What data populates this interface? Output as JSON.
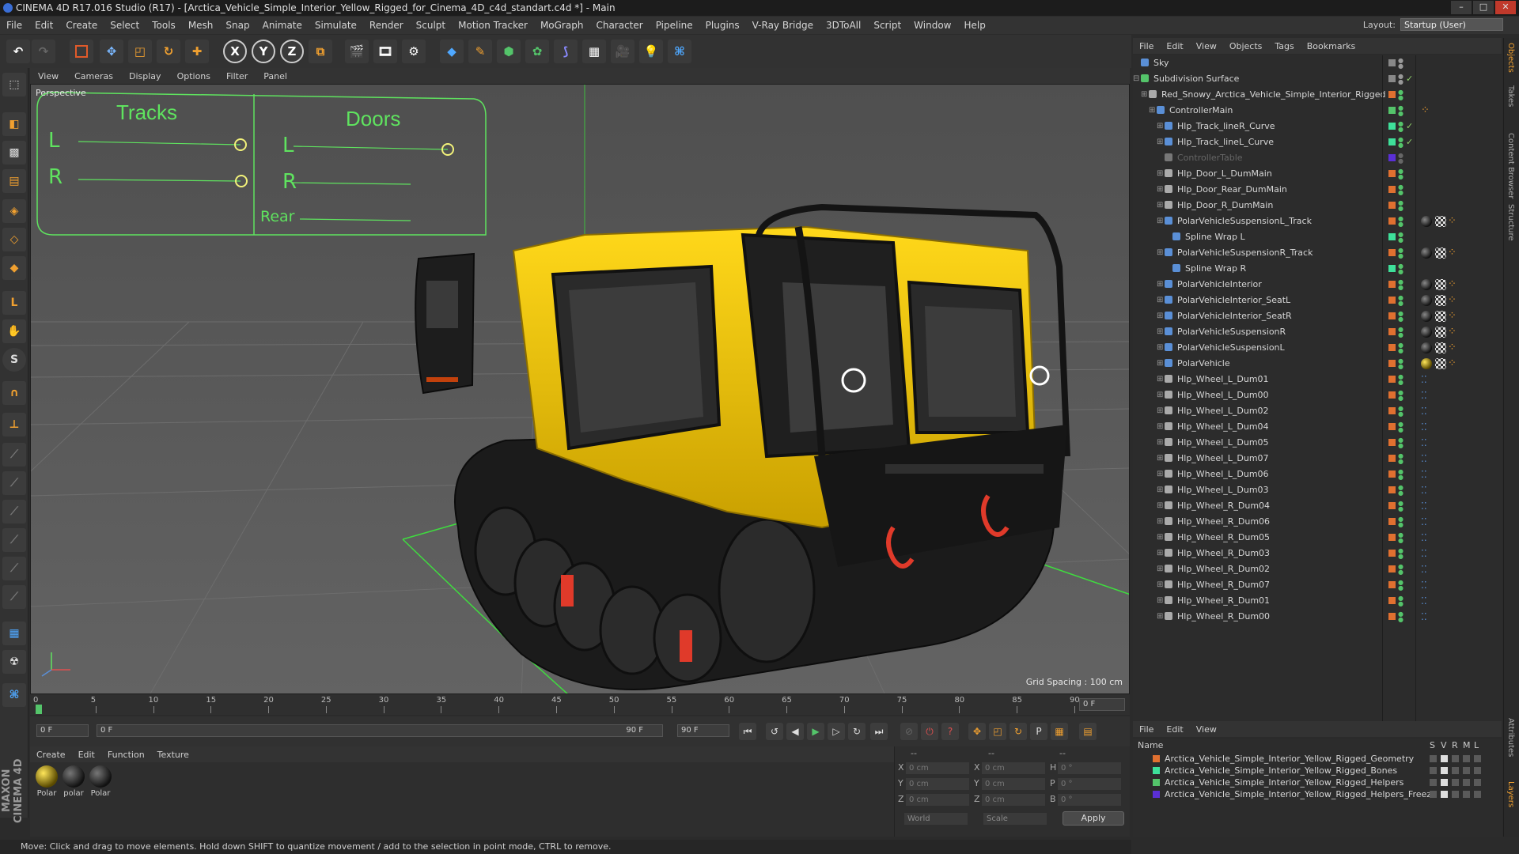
{
  "window": {
    "title": "CINEMA 4D R17.016 Studio (R17) - [Arctica_Vehicle_Simple_Interior_Yellow_Rigged_for_Cinema_4D_c4d_standart.c4d *] - Main"
  },
  "menubar": {
    "items": [
      "File",
      "Edit",
      "Create",
      "Select",
      "Tools",
      "Mesh",
      "Snap",
      "Animate",
      "Simulate",
      "Render",
      "Sculpt",
      "Motion Tracker",
      "MoGraph",
      "Character",
      "Pipeline",
      "Plugins",
      "V-Ray Bridge",
      "3DToAll",
      "Script",
      "Window",
      "Help"
    ],
    "layout_label": "Layout:",
    "layout_value": "Startup (User)"
  },
  "toolbar": {
    "axis_x": "X",
    "axis_y": "Y",
    "axis_z": "Z"
  },
  "viewport": {
    "menu": [
      "View",
      "Cameras",
      "Display",
      "Options",
      "Filter",
      "Panel"
    ],
    "label": "Perspective",
    "grid_spacing": "Grid Spacing : 100 cm",
    "hud": {
      "tracks": "Tracks",
      "doors": "Doors",
      "l": "L",
      "r": "R",
      "rear": "Rear"
    },
    "colors": {
      "bg": "#5b5b5b",
      "body": "#f2c800",
      "hud": "#5fe35f"
    }
  },
  "timeline": {
    "ticks": [
      "0",
      "5",
      "10",
      "15",
      "20",
      "25",
      "30",
      "35",
      "40",
      "45",
      "50",
      "55",
      "60",
      "65",
      "70",
      "75",
      "80",
      "85",
      "90"
    ],
    "current_frame": "0 F",
    "start_field": "0 F",
    "range_start": "0 F",
    "range_end": "90 F",
    "end_field": "90 F"
  },
  "materials": {
    "menu": [
      "Create",
      "Edit",
      "Function",
      "Texture"
    ],
    "items": [
      "Polar",
      "polar",
      "Polar"
    ]
  },
  "coords": {
    "header": [
      "--",
      "--",
      "--"
    ],
    "rows": [
      {
        "a": "X",
        "av": "0 cm",
        "b": "X",
        "bv": "0 cm",
        "c": "H",
        "cv": "0 °"
      },
      {
        "a": "Y",
        "av": "0 cm",
        "b": "Y",
        "bv": "0 cm",
        "c": "P",
        "cv": "0 °"
      },
      {
        "a": "Z",
        "av": "0 cm",
        "b": "Z",
        "bv": "0 cm",
        "c": "B",
        "cv": "0 °"
      }
    ],
    "mode": "World",
    "scale": "Scale",
    "apply": "Apply"
  },
  "status": {
    "text": "Move: Click and drag to move elements. Hold down SHIFT to quantize movement / add to the selection in point mode, CTRL to remove."
  },
  "object_manager": {
    "menu": [
      "File",
      "Edit",
      "View",
      "Objects",
      "Tags",
      "Bookmarks"
    ],
    "objects": [
      {
        "name": "Sky",
        "indent": 0,
        "layer": "#888888",
        "icon": "#5a8fd6"
      },
      {
        "name": "Subdivision Surface",
        "indent": 0,
        "layer": "#888888",
        "icon": "#54c46a",
        "check": true
      },
      {
        "name": "Red_Snowy_Arctica_Vehicle_Simple_Interior_Rigged",
        "indent": 1,
        "layer": "#e07030",
        "icon": "#aaaaaa"
      },
      {
        "name": "ControllerMain",
        "indent": 2,
        "layer": "#54c46a",
        "icon": "#5a8fd6",
        "tag": "ik"
      },
      {
        "name": "Hlp_Track_lineR_Curve",
        "indent": 3,
        "layer": "#3ee09a",
        "icon": "#5a8fd6",
        "check": true
      },
      {
        "name": "Hlp_Track_lineL_Curve",
        "indent": 3,
        "layer": "#3ee09a",
        "icon": "#5a8fd6",
        "check": true
      },
      {
        "name": "ControllerTable",
        "indent": 3,
        "layer": "#5a2fd6",
        "icon": "#777777",
        "dim": true
      },
      {
        "name": "Hlp_Door_L_DumMain",
        "indent": 3,
        "layer": "#e07030",
        "icon": "#aaaaaa"
      },
      {
        "name": "Hlp_Door_Rear_DumMain",
        "indent": 3,
        "layer": "#e07030",
        "icon": "#aaaaaa"
      },
      {
        "name": "Hlp_Door_R_DumMain",
        "indent": 3,
        "layer": "#e07030",
        "icon": "#aaaaaa"
      },
      {
        "name": "PolarVehicleSuspensionL_Track",
        "indent": 3,
        "layer": "#e07030",
        "icon": "#5a8fd6",
        "tag": "mat"
      },
      {
        "name": "Spline Wrap L",
        "indent": 4,
        "layer": "#3ee09a",
        "icon": "#5a8fd6"
      },
      {
        "name": "PolarVehicleSuspensionR_Track",
        "indent": 3,
        "layer": "#e07030",
        "icon": "#5a8fd6",
        "tag": "mat"
      },
      {
        "name": "Spline Wrap R",
        "indent": 4,
        "layer": "#3ee09a",
        "icon": "#5a8fd6"
      },
      {
        "name": "PolarVehicleInterior",
        "indent": 3,
        "layer": "#e07030",
        "icon": "#5a8fd6",
        "tag": "mat"
      },
      {
        "name": "PolarVehicleInterior_SeatL",
        "indent": 3,
        "layer": "#e07030",
        "icon": "#5a8fd6",
        "tag": "mat"
      },
      {
        "name": "PolarVehicleInterior_SeatR",
        "indent": 3,
        "layer": "#e07030",
        "icon": "#5a8fd6",
        "tag": "mat"
      },
      {
        "name": "PolarVehicleSuspensionR",
        "indent": 3,
        "layer": "#e07030",
        "icon": "#5a8fd6",
        "tag": "mat"
      },
      {
        "name": "PolarVehicleSuspensionL",
        "indent": 3,
        "layer": "#e07030",
        "icon": "#5a8fd6",
        "tag": "mat"
      },
      {
        "name": "PolarVehicle",
        "indent": 3,
        "layer": "#e07030",
        "icon": "#5a8fd6",
        "tag": "matY"
      },
      {
        "name": "Hlp_Wheel_L_Dum01",
        "indent": 3,
        "layer": "#e07030",
        "icon": "#aaaaaa",
        "tag": "dots"
      },
      {
        "name": "Hlp_Wheel_L_Dum00",
        "indent": 3,
        "layer": "#e07030",
        "icon": "#aaaaaa",
        "tag": "dots"
      },
      {
        "name": "Hlp_Wheel_L_Dum02",
        "indent": 3,
        "layer": "#e07030",
        "icon": "#aaaaaa",
        "tag": "dots"
      },
      {
        "name": "Hlp_Wheel_L_Dum04",
        "indent": 3,
        "layer": "#e07030",
        "icon": "#aaaaaa",
        "tag": "dots"
      },
      {
        "name": "Hlp_Wheel_L_Dum05",
        "indent": 3,
        "layer": "#e07030",
        "icon": "#aaaaaa",
        "tag": "dots"
      },
      {
        "name": "Hlp_Wheel_L_Dum07",
        "indent": 3,
        "layer": "#e07030",
        "icon": "#aaaaaa",
        "tag": "dots"
      },
      {
        "name": "Hlp_Wheel_L_Dum06",
        "indent": 3,
        "layer": "#e07030",
        "icon": "#aaaaaa",
        "tag": "dots"
      },
      {
        "name": "Hlp_Wheel_L_Dum03",
        "indent": 3,
        "layer": "#e07030",
        "icon": "#aaaaaa",
        "tag": "dots"
      },
      {
        "name": "Hlp_Wheel_R_Dum04",
        "indent": 3,
        "layer": "#e07030",
        "icon": "#aaaaaa",
        "tag": "dots"
      },
      {
        "name": "Hlp_Wheel_R_Dum06",
        "indent": 3,
        "layer": "#e07030",
        "icon": "#aaaaaa",
        "tag": "dots"
      },
      {
        "name": "Hlp_Wheel_R_Dum05",
        "indent": 3,
        "layer": "#e07030",
        "icon": "#aaaaaa",
        "tag": "dots"
      },
      {
        "name": "Hlp_Wheel_R_Dum03",
        "indent": 3,
        "layer": "#e07030",
        "icon": "#aaaaaa",
        "tag": "dots"
      },
      {
        "name": "Hlp_Wheel_R_Dum02",
        "indent": 3,
        "layer": "#e07030",
        "icon": "#aaaaaa",
        "tag": "dots"
      },
      {
        "name": "Hlp_Wheel_R_Dum07",
        "indent": 3,
        "layer": "#e07030",
        "icon": "#aaaaaa",
        "tag": "dots"
      },
      {
        "name": "Hlp_Wheel_R_Dum01",
        "indent": 3,
        "layer": "#e07030",
        "icon": "#aaaaaa",
        "tag": "dots"
      },
      {
        "name": "Hlp_Wheel_R_Dum00",
        "indent": 3,
        "layer": "#e07030",
        "icon": "#aaaaaa",
        "tag": "dots"
      }
    ]
  },
  "layer_manager": {
    "menu": [
      "File",
      "Edit",
      "View"
    ],
    "name_header": "Name",
    "col_headers": [
      "S",
      "V",
      "R",
      "M",
      "L"
    ],
    "layers": [
      {
        "name": "Arctica_Vehicle_Simple_Interior_Yellow_Rigged_Geometry",
        "color": "#e07030"
      },
      {
        "name": "Arctica_Vehicle_Simple_Interior_Yellow_Rigged_Bones",
        "color": "#3ee09a"
      },
      {
        "name": "Arctica_Vehicle_Simple_Interior_Yellow_Rigged_Helpers",
        "color": "#54c46a"
      },
      {
        "name": "Arctica_Vehicle_Simple_Interior_Yellow_Rigged_Helpers_Freeze",
        "color": "#5a2fd6"
      }
    ]
  },
  "right_tabs": [
    "Objects",
    "Takes",
    "Content Browser",
    "Structure",
    "Attributes",
    "Layers"
  ],
  "logo": "MAXON CINEMA 4D"
}
